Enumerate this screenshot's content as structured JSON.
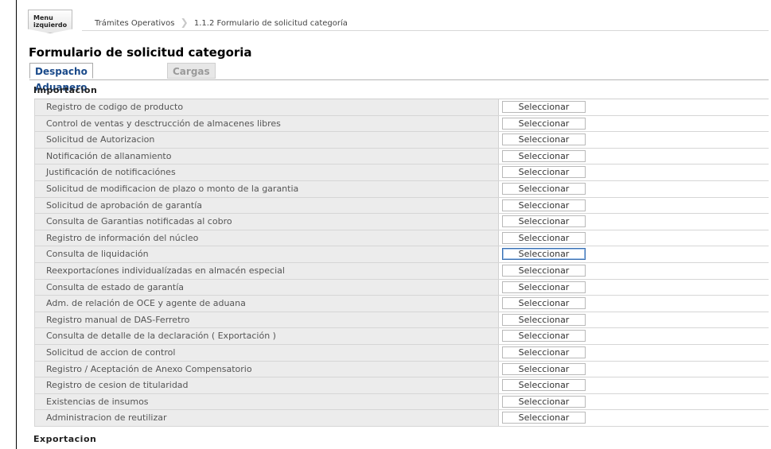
{
  "menu_button": {
    "line1": "Menu",
    "line2": "izquierdo"
  },
  "breadcrumb": {
    "level1": "Trámites Operativos",
    "sep": "❯",
    "level2": "1.1.2 Formulario de solicitud categoría"
  },
  "page_title": "Formulario de solicitud categoria",
  "tabs": [
    {
      "label": "Despacho Aduanero",
      "active": true
    },
    {
      "label": "Cargas",
      "active": false
    }
  ],
  "sections": {
    "importacion": "Importacion",
    "exportacion": "Exportacion"
  },
  "button_label": "Seleccionar",
  "focused_row_index": 9,
  "rows": [
    "Registro de codigo de producto",
    "Control de ventas y desctrucción de almacenes libres",
    "Solicitud de Autorizacion",
    "Notificación de allanamiento",
    "Justificación de notificaciónes",
    "Solicitud de modificacion de plazo o monto de la garantia",
    "Solicitud de aprobación de garantía",
    "Consulta de Garantias notificadas al cobro",
    "Registro de información del núcleo",
    "Consulta de liquidación",
    "Reexportacíones individualízadas en almacén especial",
    "Consulta de estado de garantía",
    "Adm. de relación de OCE y agente de aduana",
    "Registro manual de DAS-Ferretro",
    "Consulta de detalle de la declaración ( Exportación )",
    "Solicitud de accion de control",
    "Registro / Aceptación de Anexo Compensatorio",
    "Registro de cesion de titularidad",
    "Existencias de insumos",
    "Administracion de reutilizar"
  ]
}
